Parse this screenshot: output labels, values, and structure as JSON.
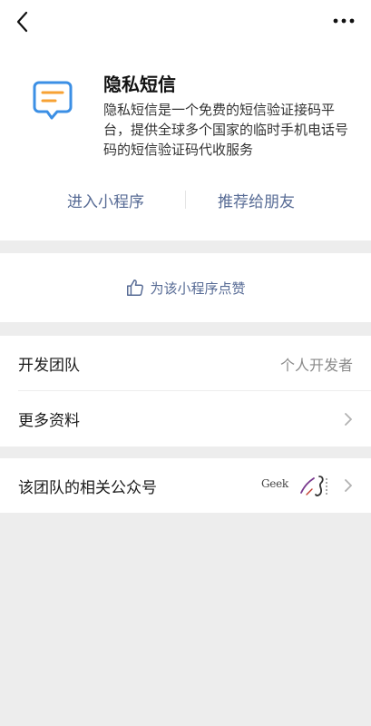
{
  "header": {
    "title": "隐私短信",
    "description": "隐私短信是一个免费的短信验证接码平台，提供全球多个国家的临时手机电话号码的短信验证码代收服务",
    "enter_label": "进入小程序",
    "share_label": "推荐给朋友",
    "icon": "message-icon",
    "accent_color": "#f7a234",
    "icon_color": "#3b8fe5"
  },
  "like": {
    "label": "为该小程序点赞",
    "icon": "thumbs-up-icon"
  },
  "info": {
    "developer_label": "开发团队",
    "developer_value": "个人开发者",
    "more_label": "更多资料"
  },
  "related": {
    "label": "该团队的相关公众号",
    "logo_text": "Geek"
  },
  "colors": {
    "link": "#576b95",
    "background": "#ededed",
    "card": "#ffffff",
    "secondary_text": "#8a8a8a"
  }
}
